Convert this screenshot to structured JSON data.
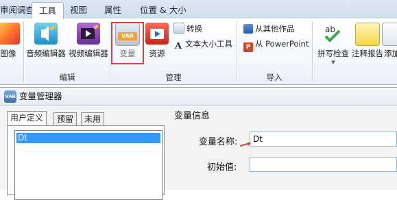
{
  "ribbon": {
    "tabs": [
      "审阅调查",
      "工具",
      "视图",
      "属性",
      "位置 & 大小"
    ],
    "active_tab": "工具",
    "groups": {
      "image": {
        "button": "图像"
      },
      "edit": {
        "label": "编辑",
        "audio": "音频编辑器",
        "video": "视频编辑器"
      },
      "manage": {
        "label": "管理",
        "variable": "变量",
        "resource": "资源",
        "convert": "转换",
        "text_size": "文本大小工具"
      },
      "import": {
        "label": "导入",
        "from_other": "从其他作品",
        "from_ppt": "从 PowerPoint"
      },
      "review": {
        "spell": "拼写检查",
        "annotation": "注释报告",
        "add": "添加"
      }
    }
  },
  "dialog": {
    "title": "变量管理器",
    "tabs": [
      "用户定义",
      "预留",
      "未用"
    ],
    "active_tab": "用户定义",
    "variables": [
      "Dt"
    ],
    "selected_variable": "Dt",
    "info_title": "变量信息",
    "name_label": "变量名称:",
    "name_value": "Dt",
    "initial_label": "初始值:",
    "initial_value": "",
    "app_icon_text": "VAR"
  },
  "colors": {
    "highlight_box": "#e03b3b",
    "selection": "#3399ff"
  }
}
